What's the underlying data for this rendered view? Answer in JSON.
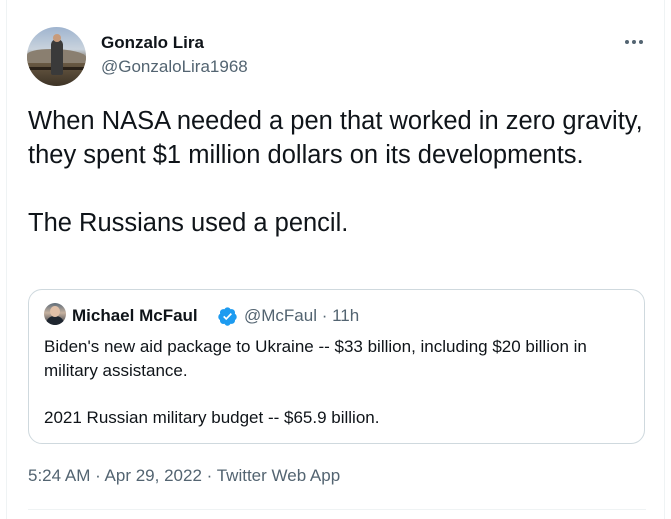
{
  "author": {
    "name": "Gonzalo Lira",
    "handle": "@GonzaloLira1968"
  },
  "tweet": {
    "paragraph1": "When NASA needed a pen that worked in zero gravity, they spent $1 million dollars on its developments.",
    "paragraph2": "The Russians used a pencil."
  },
  "quote": {
    "name": "Michael McFaul",
    "handle_time": "@McFaul · 11h",
    "paragraph1": "Biden's new aid package to Ukraine -- $33 billion, including $20 billion in military assistance.",
    "paragraph2": "2021 Russian military budget -- $65.9 billion."
  },
  "meta": {
    "time": "5:24 AM",
    "sep1": " · ",
    "date": "Apr 29, 2022",
    "sep2": " · ",
    "source": "Twitter Web App"
  },
  "icons": {
    "more": "more-horizontal-icon",
    "verified": "verified-badge-icon"
  },
  "colors": {
    "text_primary": "#0f1419",
    "text_secondary": "#536471",
    "verified_blue": "#1d9bf0",
    "border": "#cfd9de"
  }
}
